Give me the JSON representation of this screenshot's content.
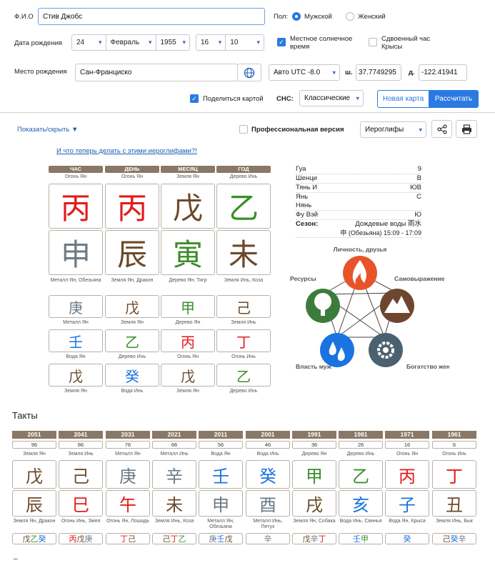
{
  "form": {
    "fio_label": "Ф.И.О",
    "fio_value": "Стив Джобс",
    "gender_label": "Пол:",
    "male": "Мужской",
    "female": "Женский",
    "birthdate_label": "Дата рождения",
    "day": "24",
    "month": "Февраль",
    "year": "1955",
    "hour": "16",
    "minute": "10",
    "solar_time": "Местное солнечное время",
    "double_rat": "Сдвоенный час Крысы",
    "birthplace_label": "Место рождения",
    "birthplace_value": "Сан-Франциско",
    "utc": "Авто UTC -8.0",
    "lat_label": "ш.",
    "lat_value": "37.7749295",
    "lon_label": "д.",
    "lon_value": "-122.41941",
    "share_chart": "Поделиться картой",
    "cnc_label": "СНС:",
    "cnc_value": "Классические",
    "new_card": "Новая карта",
    "calculate": "Рассчитать"
  },
  "toolbar": {
    "show_hide": "Показать/скрыть",
    "pro_version": "Профессиональная версия",
    "glyphs": "Иероглифы"
  },
  "help_link": "И что теперь делать с этими иероглифами?!",
  "chart": {
    "headers": [
      "ЧАС",
      "ДЕНЬ",
      "МЕСЯЦ",
      "ГОД"
    ],
    "stem_captions": [
      "Огонь Ян",
      "Огонь Ян",
      "Земля Ян",
      "Дерево Инь"
    ],
    "stems": [
      "丙",
      "丙",
      "戊",
      "乙"
    ],
    "branches": [
      "申",
      "辰",
      "寅",
      "未"
    ],
    "branch_captions": [
      "Металл Ян, Обезьяна",
      "Земля Ян, Дракон",
      "Дерево Ян, Тигр",
      "Земля Инь, Коза"
    ],
    "hidden": [
      {
        "glyphs": [
          "庚",
          "戊",
          "甲",
          "己"
        ],
        "captions": [
          "Металл Ян",
          "Земля Ян",
          "Дерево Ян",
          "Земля Инь"
        ]
      },
      {
        "glyphs": [
          "壬",
          "乙",
          "丙",
          "丁"
        ],
        "captions": [
          "Вода Ян",
          "Дерево Инь",
          "Огонь Ян",
          "Огонь Инь"
        ]
      },
      {
        "glyphs": [
          "戊",
          "癸",
          "戊",
          "乙"
        ],
        "captions": [
          "Земля Ян",
          "Вода Инь",
          "Земля Ян",
          "Дерево Инь"
        ]
      }
    ]
  },
  "info": {
    "gua_label": "Гуа",
    "gua": "9",
    "shenci_label": "Шенци",
    "shenci": "В",
    "tyan_label": "Тянь И",
    "tyan": "ЮВ",
    "yan_label": "Янь Нянь",
    "yan": "С",
    "fu_label": "Фу Вэй",
    "fu": "Ю",
    "season_label": "Сезон:",
    "season": "Дождевые воды 雨水",
    "hour_line": "申 (Обезьяна) 15:09 - 17:09"
  },
  "cycle": {
    "top": "Личность, друзья",
    "right": "Самовыражение",
    "left": "Ресурсы",
    "bottom_left": "Власть муж",
    "bottom_right": "Богатство жена"
  },
  "takty": {
    "title": "Такты",
    "years": [
      "2051",
      "2041",
      "2031",
      "2021",
      "2011",
      "2001",
      "1991",
      "1981",
      "1971",
      "1961"
    ],
    "ages": [
      "96",
      "86",
      "76",
      "66",
      "56",
      "46",
      "36",
      "26",
      "16",
      "6"
    ],
    "stem_captions": [
      "Земля Ян",
      "Земля Инь",
      "Металл Ян",
      "Металл Инь",
      "Вода Ян",
      "Вода Инь",
      "Дерево Ян",
      "Дерево Инь",
      "Огонь Ян",
      "Огонь Инь"
    ],
    "stems": [
      "戊",
      "己",
      "庚",
      "辛",
      "壬",
      "癸",
      "甲",
      "乙",
      "丙",
      "丁"
    ],
    "branches": [
      "辰",
      "巳",
      "午",
      "未",
      "申",
      "酉",
      "戌",
      "亥",
      "子",
      "丑"
    ],
    "branch_captions": [
      "Земля Ян, Дракон",
      "Огонь Инь, Змея",
      "Огонь Ян, Лошадь",
      "Земля Инь, Коза",
      "Металл Ян, Обезьяна",
      "Металл Инь, Петух",
      "Земля Ян, Собака",
      "Вода Инь, Свинья",
      "Вода Ян, Крыса",
      "Земля Инь, Бык"
    ],
    "hidden": [
      "戊乙癸",
      "丙戊庚",
      "丁己",
      "己丁乙",
      "庚壬戊",
      "辛",
      "戊辛丁",
      "壬甲",
      "癸",
      "己癸辛"
    ]
  }
}
